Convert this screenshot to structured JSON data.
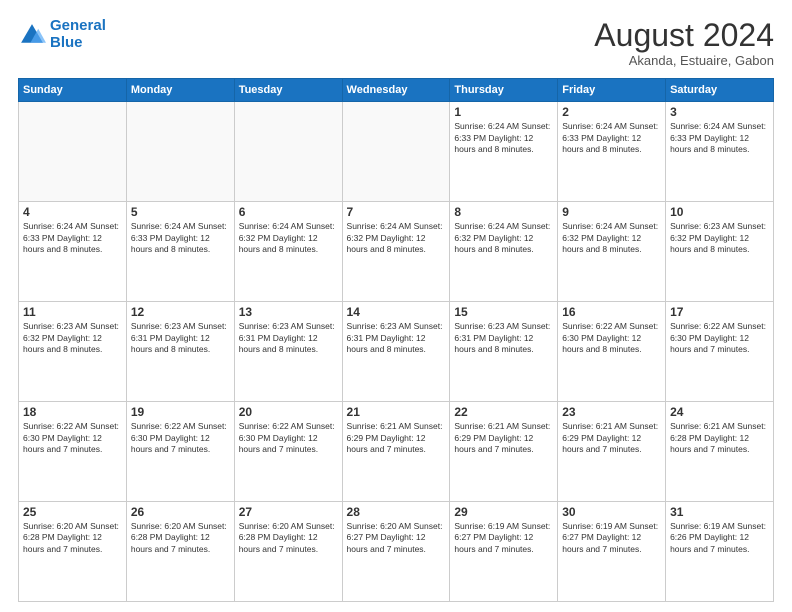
{
  "header": {
    "logo_line1": "General",
    "logo_line2": "Blue",
    "main_title": "August 2024",
    "subtitle": "Akanda, Estuaire, Gabon"
  },
  "days_of_week": [
    "Sunday",
    "Monday",
    "Tuesday",
    "Wednesday",
    "Thursday",
    "Friday",
    "Saturday"
  ],
  "weeks": [
    [
      {
        "day": "",
        "info": ""
      },
      {
        "day": "",
        "info": ""
      },
      {
        "day": "",
        "info": ""
      },
      {
        "day": "",
        "info": ""
      },
      {
        "day": "1",
        "info": "Sunrise: 6:24 AM\nSunset: 6:33 PM\nDaylight: 12 hours and 8 minutes."
      },
      {
        "day": "2",
        "info": "Sunrise: 6:24 AM\nSunset: 6:33 PM\nDaylight: 12 hours and 8 minutes."
      },
      {
        "day": "3",
        "info": "Sunrise: 6:24 AM\nSunset: 6:33 PM\nDaylight: 12 hours and 8 minutes."
      }
    ],
    [
      {
        "day": "4",
        "info": "Sunrise: 6:24 AM\nSunset: 6:33 PM\nDaylight: 12 hours and 8 minutes."
      },
      {
        "day": "5",
        "info": "Sunrise: 6:24 AM\nSunset: 6:33 PM\nDaylight: 12 hours and 8 minutes."
      },
      {
        "day": "6",
        "info": "Sunrise: 6:24 AM\nSunset: 6:32 PM\nDaylight: 12 hours and 8 minutes."
      },
      {
        "day": "7",
        "info": "Sunrise: 6:24 AM\nSunset: 6:32 PM\nDaylight: 12 hours and 8 minutes."
      },
      {
        "day": "8",
        "info": "Sunrise: 6:24 AM\nSunset: 6:32 PM\nDaylight: 12 hours and 8 minutes."
      },
      {
        "day": "9",
        "info": "Sunrise: 6:24 AM\nSunset: 6:32 PM\nDaylight: 12 hours and 8 minutes."
      },
      {
        "day": "10",
        "info": "Sunrise: 6:23 AM\nSunset: 6:32 PM\nDaylight: 12 hours and 8 minutes."
      }
    ],
    [
      {
        "day": "11",
        "info": "Sunrise: 6:23 AM\nSunset: 6:32 PM\nDaylight: 12 hours and 8 minutes."
      },
      {
        "day": "12",
        "info": "Sunrise: 6:23 AM\nSunset: 6:31 PM\nDaylight: 12 hours and 8 minutes."
      },
      {
        "day": "13",
        "info": "Sunrise: 6:23 AM\nSunset: 6:31 PM\nDaylight: 12 hours and 8 minutes."
      },
      {
        "day": "14",
        "info": "Sunrise: 6:23 AM\nSunset: 6:31 PM\nDaylight: 12 hours and 8 minutes."
      },
      {
        "day": "15",
        "info": "Sunrise: 6:23 AM\nSunset: 6:31 PM\nDaylight: 12 hours and 8 minutes."
      },
      {
        "day": "16",
        "info": "Sunrise: 6:22 AM\nSunset: 6:30 PM\nDaylight: 12 hours and 8 minutes."
      },
      {
        "day": "17",
        "info": "Sunrise: 6:22 AM\nSunset: 6:30 PM\nDaylight: 12 hours and 7 minutes."
      }
    ],
    [
      {
        "day": "18",
        "info": "Sunrise: 6:22 AM\nSunset: 6:30 PM\nDaylight: 12 hours and 7 minutes."
      },
      {
        "day": "19",
        "info": "Sunrise: 6:22 AM\nSunset: 6:30 PM\nDaylight: 12 hours and 7 minutes."
      },
      {
        "day": "20",
        "info": "Sunrise: 6:22 AM\nSunset: 6:30 PM\nDaylight: 12 hours and 7 minutes."
      },
      {
        "day": "21",
        "info": "Sunrise: 6:21 AM\nSunset: 6:29 PM\nDaylight: 12 hours and 7 minutes."
      },
      {
        "day": "22",
        "info": "Sunrise: 6:21 AM\nSunset: 6:29 PM\nDaylight: 12 hours and 7 minutes."
      },
      {
        "day": "23",
        "info": "Sunrise: 6:21 AM\nSunset: 6:29 PM\nDaylight: 12 hours and 7 minutes."
      },
      {
        "day": "24",
        "info": "Sunrise: 6:21 AM\nSunset: 6:28 PM\nDaylight: 12 hours and 7 minutes."
      }
    ],
    [
      {
        "day": "25",
        "info": "Sunrise: 6:20 AM\nSunset: 6:28 PM\nDaylight: 12 hours and 7 minutes."
      },
      {
        "day": "26",
        "info": "Sunrise: 6:20 AM\nSunset: 6:28 PM\nDaylight: 12 hours and 7 minutes."
      },
      {
        "day": "27",
        "info": "Sunrise: 6:20 AM\nSunset: 6:28 PM\nDaylight: 12 hours and 7 minutes."
      },
      {
        "day": "28",
        "info": "Sunrise: 6:20 AM\nSunset: 6:27 PM\nDaylight: 12 hours and 7 minutes."
      },
      {
        "day": "29",
        "info": "Sunrise: 6:19 AM\nSunset: 6:27 PM\nDaylight: 12 hours and 7 minutes."
      },
      {
        "day": "30",
        "info": "Sunrise: 6:19 AM\nSunset: 6:27 PM\nDaylight: 12 hours and 7 minutes."
      },
      {
        "day": "31",
        "info": "Sunrise: 6:19 AM\nSunset: 6:26 PM\nDaylight: 12 hours and 7 minutes."
      }
    ]
  ]
}
